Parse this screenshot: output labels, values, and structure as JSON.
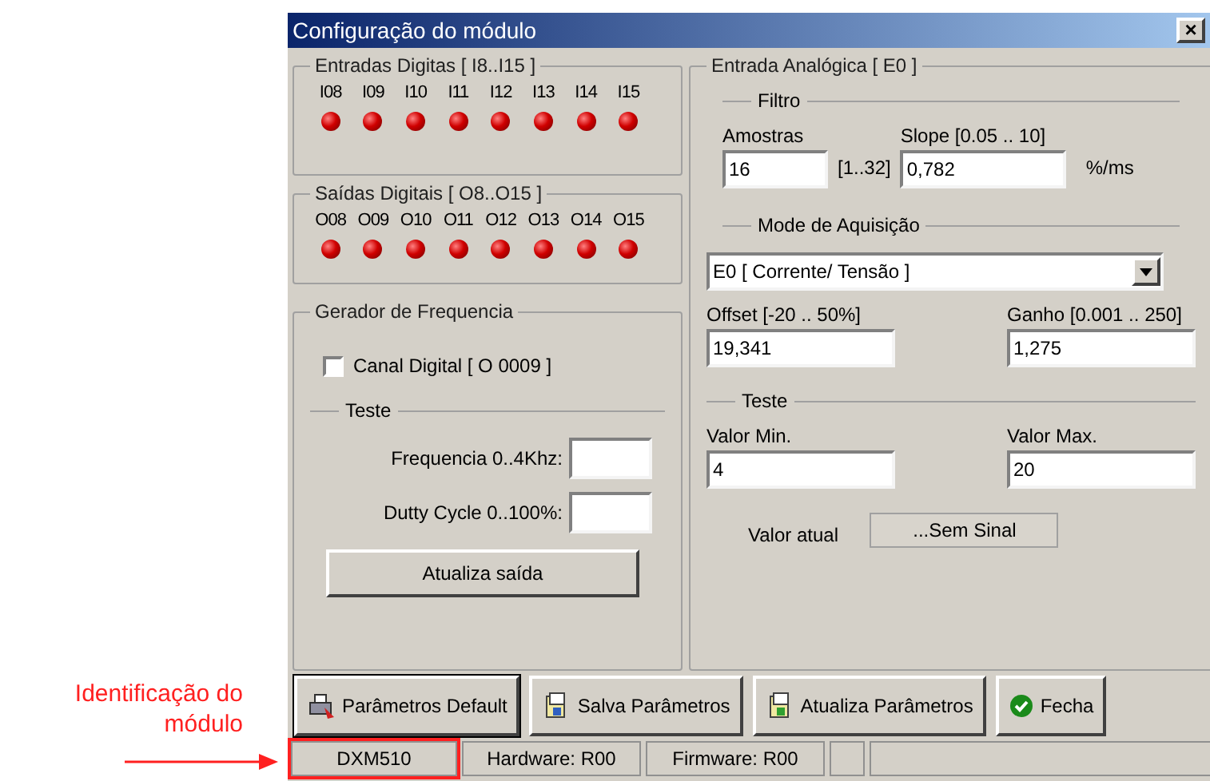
{
  "annotation": {
    "text": "Identificação do módulo"
  },
  "window": {
    "title": "Configuração do módulo",
    "close": "×"
  },
  "digital_inputs": {
    "title": "Entradas Digitas [ I8..I15 ]",
    "channels": [
      {
        "label": "I08",
        "on": true
      },
      {
        "label": "I09",
        "on": true
      },
      {
        "label": "I10",
        "on": true
      },
      {
        "label": "I11",
        "on": true
      },
      {
        "label": "I12",
        "on": true
      },
      {
        "label": "I13",
        "on": true
      },
      {
        "label": "I14",
        "on": true
      },
      {
        "label": "I15",
        "on": true
      }
    ]
  },
  "digital_outputs": {
    "title": "Saídas Digitais [ O8..O15 ]",
    "channels": [
      {
        "label": "O08",
        "on": true
      },
      {
        "label": "O09",
        "on": true
      },
      {
        "label": "O10",
        "on": true
      },
      {
        "label": "O11",
        "on": true
      },
      {
        "label": "O12",
        "on": true
      },
      {
        "label": "O13",
        "on": true
      },
      {
        "label": "O14",
        "on": true
      },
      {
        "label": "O15",
        "on": true
      }
    ]
  },
  "frequency_generator": {
    "title": "Gerador de Frequencia",
    "checkbox": {
      "label": "Canal Digital [ O 0009 ]",
      "checked": false
    },
    "test_title": "Teste",
    "fields": [
      {
        "label": "Frequencia 0..4Khz:"
      },
      {
        "label": "Dutty Cycle 0..100%:"
      }
    ],
    "button": "Atualiza saída"
  },
  "analog_input": {
    "title": "Entrada Analógica [ E0 ]",
    "filter_title": "Filtro",
    "samples": {
      "label": "Amostras",
      "value": "16",
      "range": "[1..32]"
    },
    "slope": {
      "label": "Slope [0.05 .. 10]",
      "value": "0,782",
      "unit": "%/ms"
    },
    "mode_title": "Mode de Aquisição",
    "mode": "E0 [ Corrente/ Tensão ]",
    "offset": {
      "label": "Offset [-20 .. 50%]",
      "value": "19,341"
    },
    "gain": {
      "label": "Ganho [0.001 .. 250]",
      "value": "1,275"
    },
    "test_title": "Teste",
    "min": {
      "label": "Valor Min.",
      "value": "4"
    },
    "max": {
      "label": "Valor Max.",
      "value": "20"
    },
    "current": {
      "label": "Valor atual",
      "value": "...Sem Sinal"
    }
  },
  "buttons": [
    {
      "label": "Parâmetros Default",
      "kind": "default",
      "focused": true
    },
    {
      "label": "Salva Parâmetros",
      "kind": "save",
      "focused": false
    },
    {
      "label": "Atualiza Parâmetros",
      "kind": "update",
      "focused": false
    },
    {
      "label": "Fecha",
      "kind": "close",
      "focused": false
    }
  ],
  "status_bar": [
    {
      "text": "DXM510",
      "highlighted": true
    },
    {
      "text": "Hardware: R00",
      "highlighted": false
    },
    {
      "text": "Firmware: R00",
      "highlighted": false
    }
  ]
}
